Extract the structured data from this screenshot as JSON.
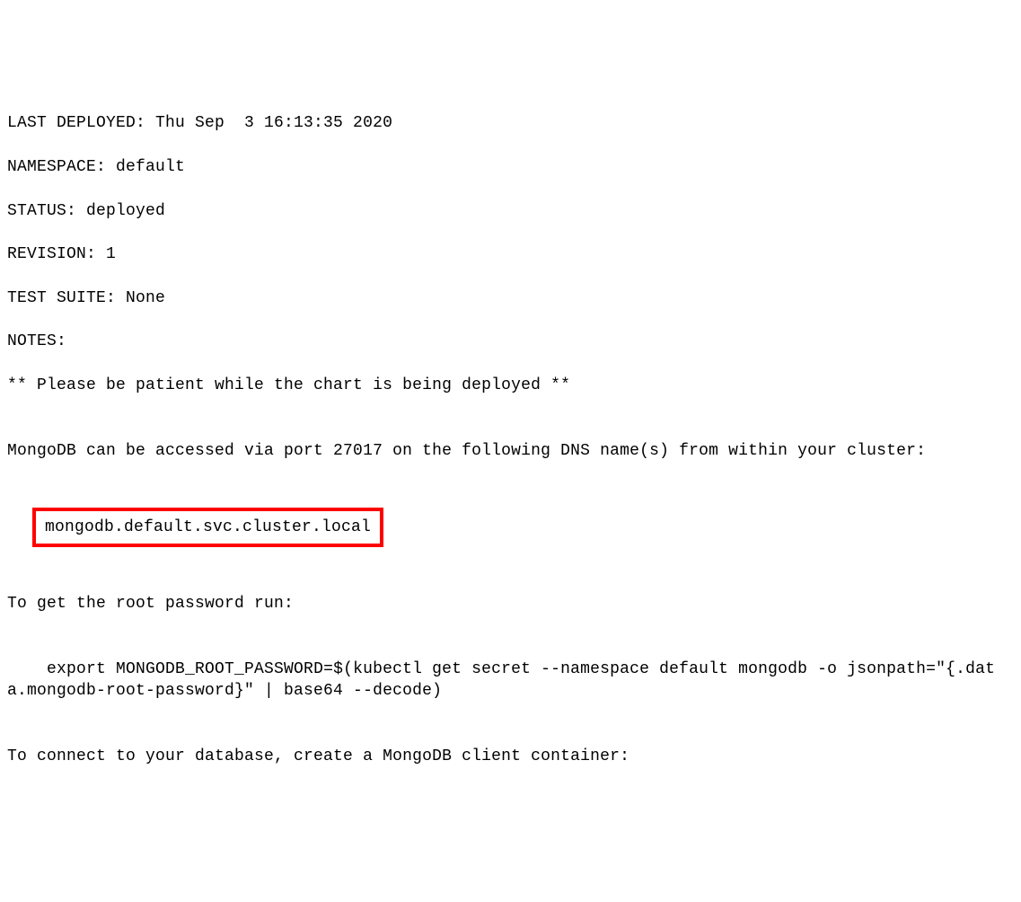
{
  "lines": {
    "l1": "LAST DEPLOYED: Thu Sep  3 16:13:35 2020",
    "l2": "NAMESPACE: default",
    "l3": "STATUS: deployed",
    "l4": "REVISION: 1",
    "l5": "TEST SUITE: None",
    "l6": "NOTES:",
    "l7": "** Please be patient while the chart is being deployed **",
    "l8": "",
    "l9": "MongoDB can be accessed via port 27017 on the following DNS name(s) from within your cluster:",
    "l10": "",
    "dns": "mongodb.default.svc.cluster.local",
    "l11": "",
    "l12": "To get the root password run:",
    "l13": "",
    "l14": "    export MONGODB_ROOT_PASSWORD=$(kubectl get secret --namespace default mongodb -o jsonpath=\"{.data.mongodb-root-password}\" | base64 --decode)",
    "l15": "",
    "l16": "To connect to your database, create a MongoDB client container:"
  },
  "highlight_color": "#ff0000"
}
